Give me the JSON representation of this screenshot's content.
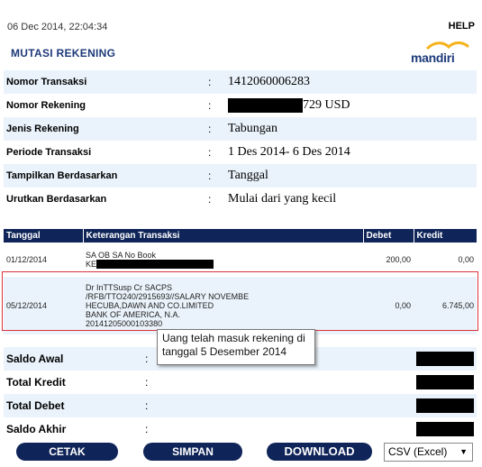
{
  "header": {
    "datetime": "06 Dec 2014, 22:04:34",
    "help_label": "HELP",
    "page_title": "MUTASI REKENING",
    "logo_text": "mandiri",
    "logo_color": "#f5b21b"
  },
  "account_info": [
    {
      "label": "Nomor Transaksi",
      "value": "1412060006283"
    },
    {
      "label": "Nomor Rekening",
      "value": "729 USD",
      "redacted_prefix": true
    },
    {
      "label": "Jenis Rekening",
      "value": "Tabungan"
    },
    {
      "label": "Periode Transaksi",
      "value": "1 Des 2014- 6 Des 2014"
    },
    {
      "label": "Tampilkan Berdasarkan",
      "value": "Tanggal"
    },
    {
      "label": "Urutkan Berdasarkan",
      "value": "Mulai dari yang kecil"
    }
  ],
  "transactions": {
    "columns": [
      "Tanggal",
      "Keterangan Transaksi",
      "Debet",
      "Kredit"
    ],
    "rows": [
      {
        "date": "01/12/2014",
        "desc_lines": [
          "SA OB SA No Book",
          "KE"
        ],
        "debet": "200,00",
        "kredit": "0,00"
      },
      {
        "date": "05/12/2014",
        "desc_lines": [
          "Dr InTTSusp Cr SACPS",
          "/RFB/TTO240/2915693//SALARY NOVEMBE",
          "HECUBA,DAWN AND CO.LIMITED",
          "BANK OF AMERICA, N.A.",
          "20141205000103380"
        ],
        "debet": "0,00",
        "kredit": "6.745,00"
      }
    ]
  },
  "tooltip": {
    "text_line1": "Uang telah masuk rekening di",
    "text_line2": "tanggal 5 Desember 2014"
  },
  "summary": [
    {
      "label": "Saldo Awal"
    },
    {
      "label": "Total Kredit"
    },
    {
      "label": "Total Debet"
    },
    {
      "label": "Saldo Akhir"
    }
  ],
  "actions": {
    "print_label": "CETAK",
    "save_label": "SIMPAN",
    "download_label": "DOWNLOAD",
    "format_selected": "CSV (Excel)"
  },
  "colors": {
    "header_navy": "#0f2458",
    "title_blue": "#1d3a7a",
    "row_alt": "#eaf3fb",
    "highlight_red": "#d9323a"
  }
}
